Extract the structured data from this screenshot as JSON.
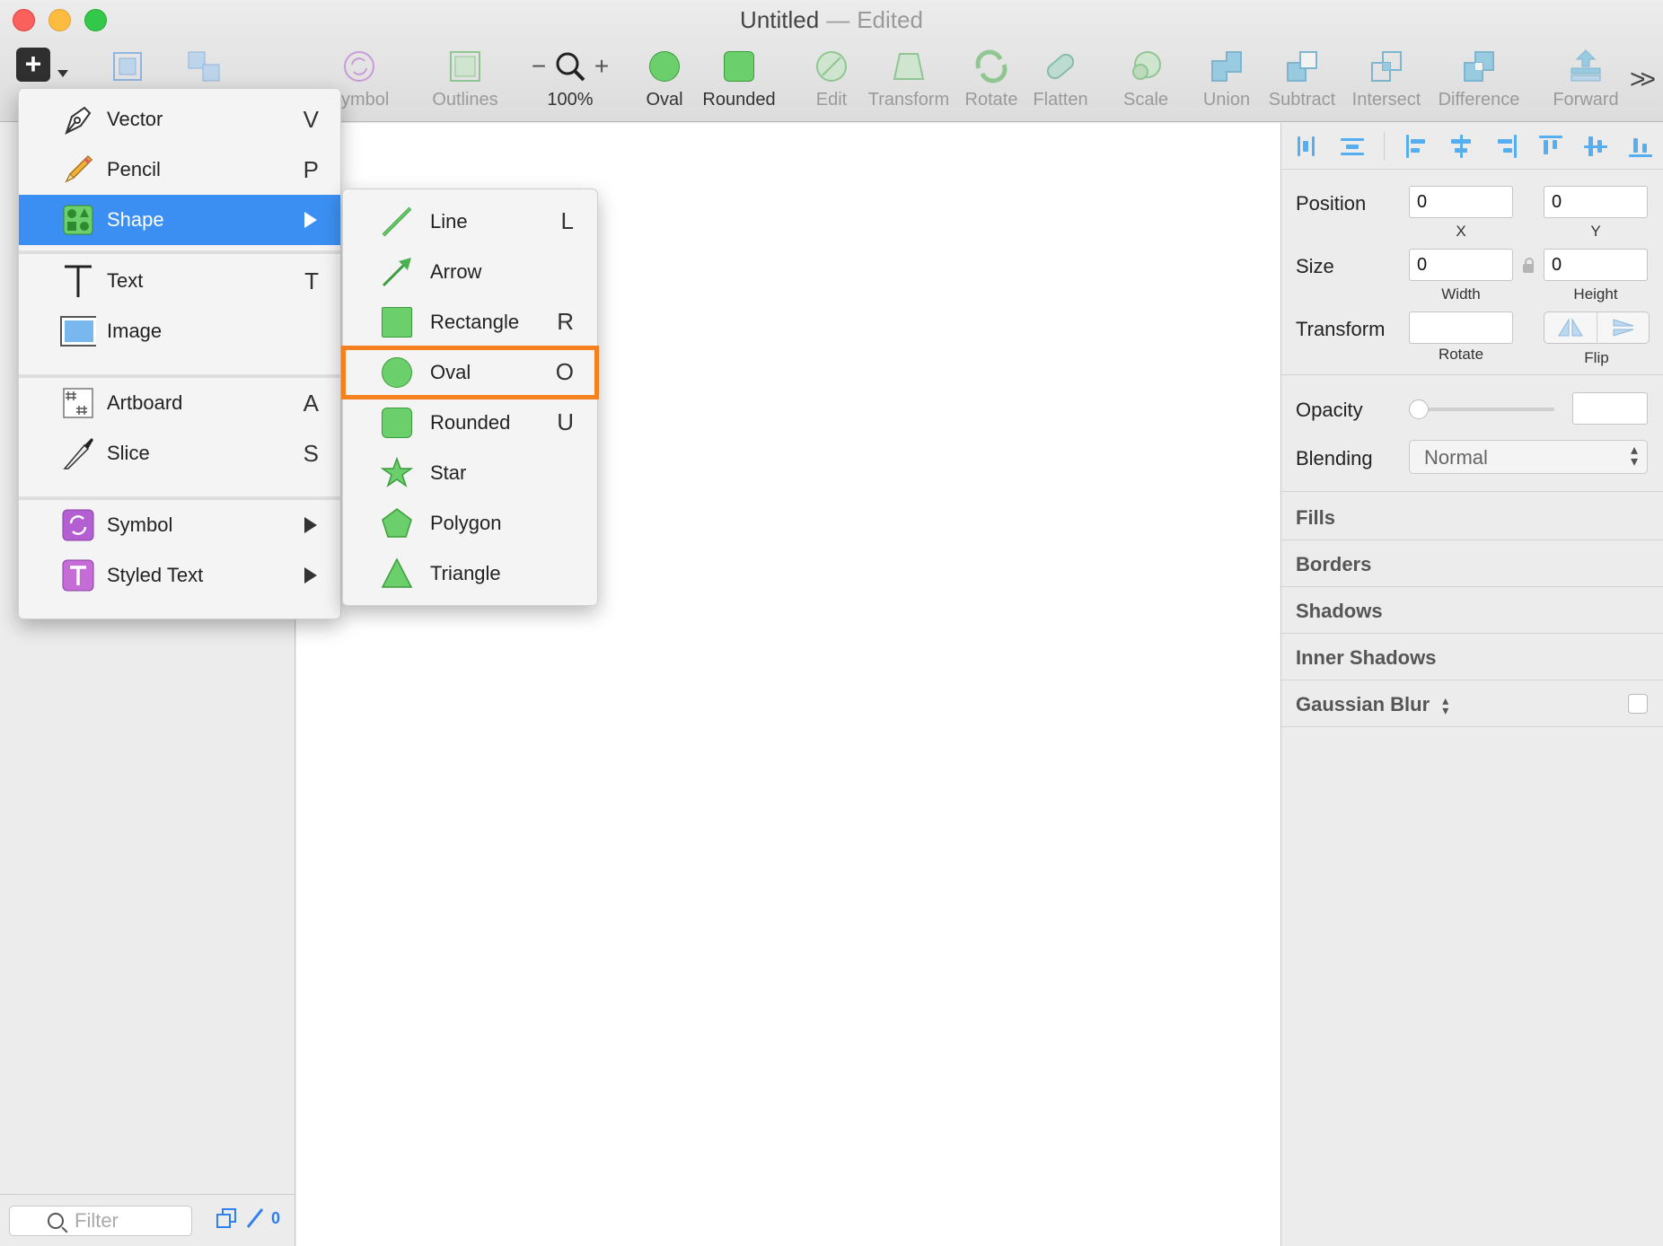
{
  "window": {
    "title": "Untitled",
    "separator": "—",
    "status": "Edited"
  },
  "toolbar": {
    "items": [
      {
        "label": "Symbol",
        "icon": "symbol-icon",
        "enabled": false
      },
      {
        "label": "Outlines",
        "icon": "outlines-icon",
        "enabled": false
      },
      {
        "label": "100%",
        "icon": "zoom-icon",
        "enabled": true
      },
      {
        "label": "Oval",
        "icon": "oval-icon",
        "enabled": true
      },
      {
        "label": "Rounded",
        "icon": "rounded-rect-icon",
        "enabled": true
      },
      {
        "label": "Edit",
        "icon": "edit-icon",
        "enabled": false
      },
      {
        "label": "Transform",
        "icon": "transform-icon",
        "enabled": false
      },
      {
        "label": "Rotate",
        "icon": "rotate-icon",
        "enabled": false
      },
      {
        "label": "Flatten",
        "icon": "flatten-icon",
        "enabled": false
      },
      {
        "label": "Scale",
        "icon": "scale-icon",
        "enabled": false
      },
      {
        "label": "Union",
        "icon": "union-icon",
        "enabled": false
      },
      {
        "label": "Subtract",
        "icon": "subtract-icon",
        "enabled": false
      },
      {
        "label": "Intersect",
        "icon": "intersect-icon",
        "enabled": false
      },
      {
        "label": "Difference",
        "icon": "difference-icon",
        "enabled": false
      },
      {
        "label": "Forward",
        "icon": "forward-icon",
        "enabled": false
      }
    ],
    "zoom_minus": "−",
    "zoom_plus": "+",
    "insert_symbol": "+",
    "more_symbol": ">>"
  },
  "insert_menu": {
    "items": [
      {
        "label": "Vector",
        "shortcut": "V",
        "icon": "vector-pen-icon"
      },
      {
        "label": "Pencil",
        "shortcut": "P",
        "icon": "pencil-icon"
      },
      {
        "label": "Shape",
        "shortcut": "",
        "icon": "shape-icon",
        "submenu": true,
        "active": true
      },
      {
        "label": "Text",
        "shortcut": "T",
        "icon": "text-icon"
      },
      {
        "label": "Image",
        "shortcut": "",
        "icon": "image-icon"
      },
      {
        "label": "Artboard",
        "shortcut": "A",
        "icon": "artboard-icon"
      },
      {
        "label": "Slice",
        "shortcut": "S",
        "icon": "slice-knife-icon"
      },
      {
        "label": "Symbol",
        "shortcut": "",
        "icon": "symbol-icon",
        "submenu": true
      },
      {
        "label": "Styled Text",
        "shortcut": "",
        "icon": "styled-text-icon",
        "submenu": true
      }
    ]
  },
  "shape_submenu": {
    "items": [
      {
        "label": "Line",
        "shortcut": "L",
        "icon": "line-icon"
      },
      {
        "label": "Arrow",
        "shortcut": "",
        "icon": "arrow-icon"
      },
      {
        "label": "Rectangle",
        "shortcut": "R",
        "icon": "rectangle-icon"
      },
      {
        "label": "Oval",
        "shortcut": "O",
        "icon": "oval-icon",
        "highlighted": true
      },
      {
        "label": "Rounded",
        "shortcut": "U",
        "icon": "rounded-rect-icon"
      },
      {
        "label": "Star",
        "shortcut": "",
        "icon": "star-icon"
      },
      {
        "label": "Polygon",
        "shortcut": "",
        "icon": "polygon-icon"
      },
      {
        "label": "Triangle",
        "shortcut": "",
        "icon": "triangle-icon"
      }
    ]
  },
  "layers_footer": {
    "filter_placeholder": "Filter",
    "count": "0"
  },
  "inspector": {
    "position": {
      "label": "Position",
      "x": "0",
      "y": "0",
      "x_label": "X",
      "y_label": "Y"
    },
    "size": {
      "label": "Size",
      "width": "0",
      "height": "0",
      "width_label": "Width",
      "height_label": "Height"
    },
    "transform": {
      "label": "Transform",
      "rotate": "",
      "rotate_label": "Rotate",
      "flip_label": "Flip"
    },
    "opacity": {
      "label": "Opacity",
      "value": "",
      "level": 0
    },
    "blending": {
      "label": "Blending",
      "value": "Normal"
    },
    "sections": [
      "Fills",
      "Borders",
      "Shadows",
      "Inner Shadows",
      "Gaussian Blur"
    ]
  },
  "colors": {
    "accent": "#3c8ff2",
    "highlight": "#f7801e",
    "shape_green": "#6bd06b",
    "symbol_purple": "#b35fd1"
  }
}
